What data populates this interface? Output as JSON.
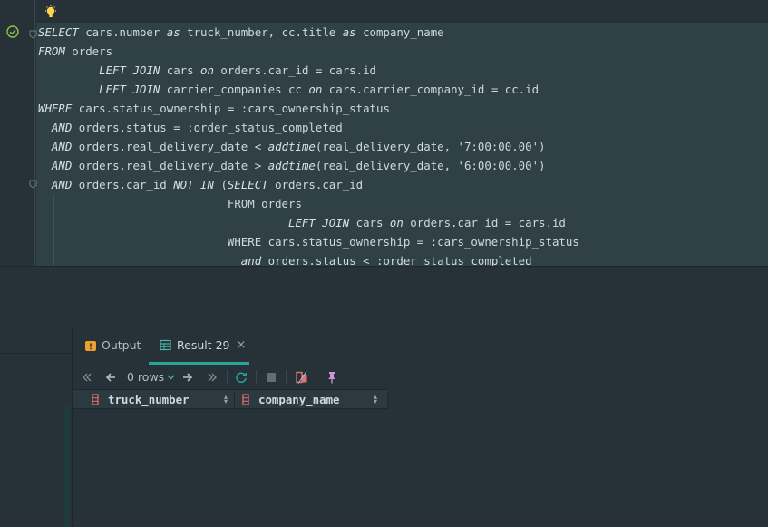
{
  "editor": {
    "lines": [
      [
        {
          "t": "SELECT",
          "k": 1
        },
        {
          "t": " cars.number "
        },
        {
          "t": "as",
          "k": 1
        },
        {
          "t": " truck_number, cc.title "
        },
        {
          "t": "as",
          "k": 1
        },
        {
          "t": " company_name"
        }
      ],
      [
        {
          "t": "FROM",
          "k": 1
        },
        {
          "t": " orders"
        }
      ],
      [
        {
          "t": "         "
        },
        {
          "t": "LEFT JOIN",
          "k": 1
        },
        {
          "t": " cars "
        },
        {
          "t": "on",
          "k": 1
        },
        {
          "t": " orders.car_id = cars.id"
        }
      ],
      [
        {
          "t": "         "
        },
        {
          "t": "LEFT JOIN",
          "k": 1
        },
        {
          "t": " carrier_companies cc "
        },
        {
          "t": "on",
          "k": 1
        },
        {
          "t": " cars.carrier_company_id = cc.id"
        }
      ],
      [
        {
          "t": "WHERE",
          "k": 1
        },
        {
          "t": " cars.status_ownership = :cars_ownership_status"
        }
      ],
      [
        {
          "t": "  "
        },
        {
          "t": "AND",
          "k": 1
        },
        {
          "t": " orders.status = :order_status_completed"
        }
      ],
      [
        {
          "t": "  "
        },
        {
          "t": "AND",
          "k": 1
        },
        {
          "t": " orders.real_delivery_date < "
        },
        {
          "t": "addtime",
          "k": 1
        },
        {
          "t": "(real_delivery_date, '7:00:00.00')"
        }
      ],
      [
        {
          "t": "  "
        },
        {
          "t": "AND",
          "k": 1
        },
        {
          "t": " orders.real_delivery_date > "
        },
        {
          "t": "addtime",
          "k": 1
        },
        {
          "t": "(real_delivery_date, '6:00:00.00')"
        }
      ],
      [
        {
          "t": "  "
        },
        {
          "t": "AND",
          "k": 1
        },
        {
          "t": " orders.car_id "
        },
        {
          "t": "NOT IN",
          "k": 1
        },
        {
          "t": " ("
        },
        {
          "t": "SELECT",
          "k": 1
        },
        {
          "t": " orders.car_id"
        }
      ],
      [
        {
          "t": "                            FROM orders"
        }
      ],
      [
        {
          "t": "                                     "
        },
        {
          "t": "LEFT JOIN",
          "k": 1
        },
        {
          "t": " cars "
        },
        {
          "t": "on",
          "k": 1
        },
        {
          "t": " orders.car_id = cars.id"
        }
      ],
      [
        {
          "t": "                            WHERE cars.status_ownership = :cars_ownership_status"
        }
      ],
      [
        {
          "t": "                              "
        },
        {
          "t": "and",
          "k": 1
        },
        {
          "t": " orders.status < :order status completed"
        }
      ]
    ]
  },
  "tabs": {
    "output_label": "Output",
    "result_label": "Result 29",
    "close_glyph": "×"
  },
  "toolbar": {
    "rows_label": "0 rows"
  },
  "grid": {
    "columns": [
      "truck_number",
      "company_name"
    ]
  },
  "colors": {
    "accent": "#26a69a",
    "code_highlight": "#2f4145",
    "background": "#263238"
  }
}
